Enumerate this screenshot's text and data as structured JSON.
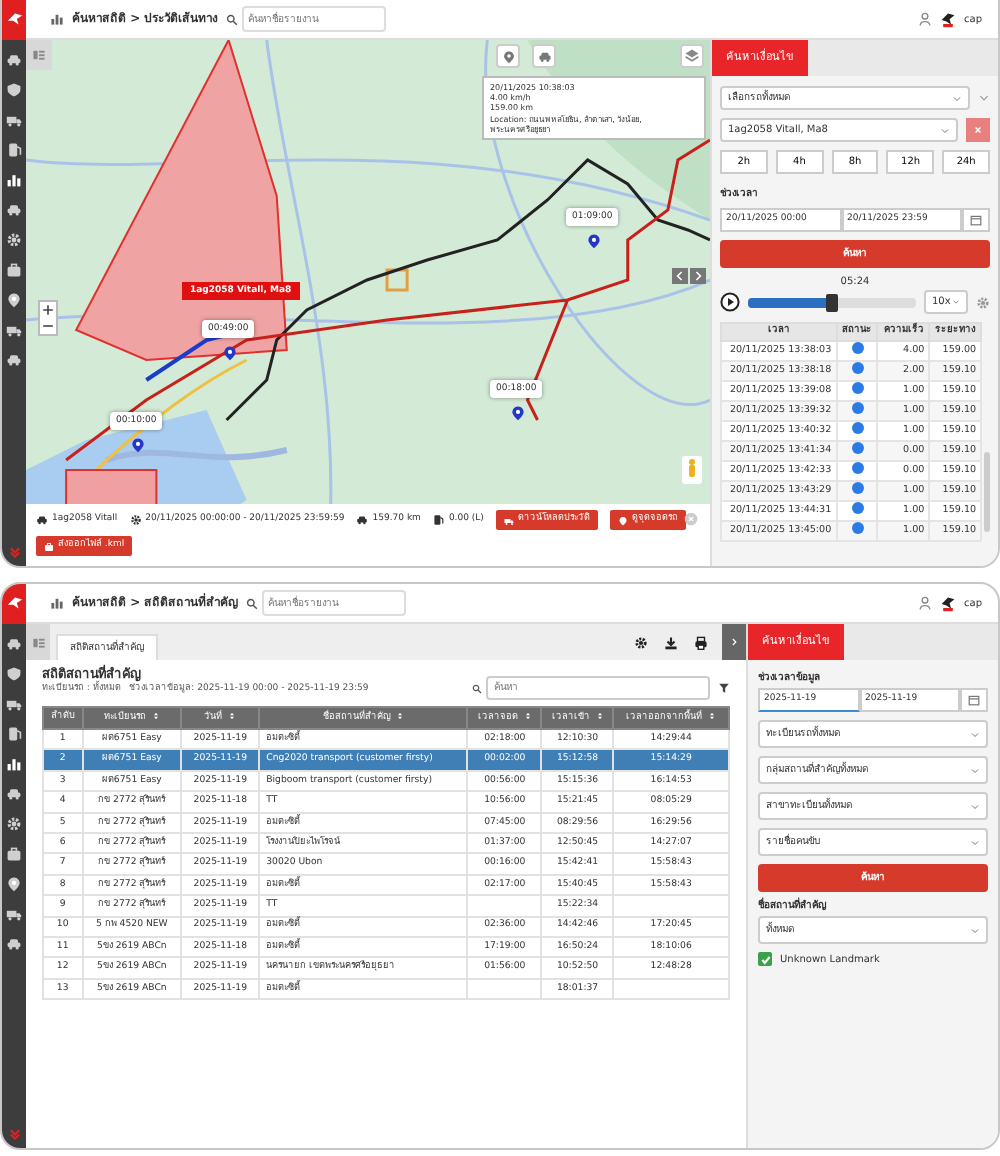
{
  "history_screen": {
    "breadcrumb": "ค้นหาสถิติ > ประวัติเส้นทาง",
    "search": {
      "placeholder": "ค้นหาชื่อรายงาน"
    },
    "user": "cap",
    "map": {
      "info_lines": [
        "20/11/2025 10:38:03",
        "4.00 km/h",
        "159.00 km",
        "Location: ถนนพหลโยธิน, ลำตาเสา, วังน้อย, พระนครศรีอยุธยา"
      ],
      "time_labels": [
        "01:09:00",
        "00:18:00",
        "00:49:00",
        "00:10:00"
      ],
      "vehicle_label": "1ag2058 Vitall, Ma8",
      "summary": {
        "plate": "1ag2058 Vitall",
        "period": "20/11/2025 00:00:00 - 20/11/2025 23:59:59",
        "distance": "159.70 km",
        "fuel": "0.00 (L)"
      },
      "buttons": [
        "ดาวน์โหลดประวัติ",
        "ดูจุดจอดรถ",
        "ส่งออกไฟล์ .kml"
      ]
    },
    "panel": {
      "tab": "ค้นหาเงื่อนไข",
      "group_select": "เลือกรถทั้งหมด",
      "vehicle_select": "1ag2058 Vitall, Ma8",
      "ranges": [
        {
          "label": "2h",
          "selected": false
        },
        {
          "label": "4h",
          "selected": false
        },
        {
          "label": "8h",
          "selected": false
        },
        {
          "label": "12h",
          "selected": false
        },
        {
          "label": "24h",
          "selected": false
        }
      ],
      "period_label": "ช่วงเวลา",
      "date_from": "20/11/2025 00:00",
      "date_to": "20/11/2025 23:59",
      "search_button": "ค้นหา",
      "playback": {
        "time": "05:24",
        "level": 0.5,
        "speed": "10x"
      },
      "table": {
        "columns": [
          "เวลา",
          "สถานะ",
          "ความเร็ว",
          "ระยะทาง"
        ],
        "rows": [
          {
            "time": "20/11/2025 13:38:03",
            "speed": "4.00",
            "distance": "159.00"
          },
          {
            "time": "20/11/2025 13:38:18",
            "speed": "2.00",
            "distance": "159.10"
          },
          {
            "time": "20/11/2025 13:39:08",
            "speed": "1.00",
            "distance": "159.10"
          },
          {
            "time": "20/11/2025 13:39:32",
            "speed": "1.00",
            "distance": "159.10"
          },
          {
            "time": "20/11/2025 13:40:32",
            "speed": "1.00",
            "distance": "159.10"
          },
          {
            "time": "20/11/2025 13:41:34",
            "speed": "0.00",
            "distance": "159.10"
          },
          {
            "time": "20/11/2025 13:42:33",
            "speed": "0.00",
            "distance": "159.10"
          },
          {
            "time": "20/11/2025 13:43:29",
            "speed": "1.00",
            "distance": "159.10"
          },
          {
            "time": "20/11/2025 13:44:31",
            "speed": "1.00",
            "distance": "159.10"
          },
          {
            "time": "20/11/2025 13:45:00",
            "speed": "1.00",
            "distance": "159.10"
          }
        ]
      }
    }
  },
  "landmark_screen": {
    "breadcrumb": "ค้นหาสถิติ > สถิติสถานที่สำคัญ",
    "search": {
      "placeholder": "ค้นหาชื่อรายงาน"
    },
    "user": "cap",
    "tab": "สถิติสถานที่สำคัญ",
    "title": "สถิติสถานที่สำคัญ",
    "subtitle": "ทะเบียนรถ : ทั้งหมด   ช่วงเวลาข้อมูล: 2025-11-19 00:00 - 2025-11-19 23:59",
    "table_search": {
      "placeholder": "ค้นหา"
    },
    "table": {
      "columns": [
        "ลำดับ",
        "ทะเบียนรถ",
        "วันที่",
        "ชื่อสถานที่สำคัญ",
        "เวลาจอด",
        "เวลาเข้า",
        "เวลาออกจากพื้นที่"
      ],
      "rows": [
        {
          "cells": [
            "1",
            "ผต6751 Easy",
            "2025-11-19",
            "อมตะซิตี้",
            "02:18:00",
            "12:10:30",
            "14:29:44"
          ],
          "selected": false
        },
        {
          "cells": [
            "2",
            "ผต6751 Easy",
            "2025-11-19",
            "Cng2020 transport (customer firsty)",
            "00:02:00",
            "15:12:58",
            "15:14:29"
          ],
          "selected": true
        },
        {
          "cells": [
            "3",
            "ผต6751 Easy",
            "2025-11-19",
            "Bigboom transport (customer firsty)",
            "00:56:00",
            "15:15:36",
            "16:14:53"
          ],
          "selected": false
        },
        {
          "cells": [
            "4",
            "กข 2772 สุรินทร์",
            "2025-11-18",
            "TT",
            "10:56:00",
            "15:21:45",
            "08:05:29"
          ],
          "selected": false
        },
        {
          "cells": [
            "5",
            "กข 2772 สุรินทร์",
            "2025-11-19",
            "อมตะซิตี้",
            "07:45:00",
            "08:29:56",
            "16:29:56"
          ],
          "selected": false
        },
        {
          "cells": [
            "6",
            "กข 2772 สุรินทร์",
            "2025-11-19",
            "โรงงานปิยะไพโรจน์",
            "01:37:00",
            "12:50:45",
            "14:27:07"
          ],
          "selected": false
        },
        {
          "cells": [
            "7",
            "กข 2772 สุรินทร์",
            "2025-11-19",
            "30020 Ubon",
            "00:16:00",
            "15:42:41",
            "15:58:43"
          ],
          "selected": false
        },
        {
          "cells": [
            "8",
            "กข 2772 สุรินทร์",
            "2025-11-19",
            "อมตะซิตี้",
            "02:17:00",
            "15:40:45",
            "15:58:43"
          ],
          "selected": false
        },
        {
          "cells": [
            "9",
            "กข 2772 สุรินทร์",
            "2025-11-19",
            "TT",
            "",
            "15:22:34",
            ""
          ],
          "selected": false
        },
        {
          "cells": [
            "10",
            "5 กพ 4520 NEW",
            "2025-11-19",
            "อมตะซิตี้",
            "02:36:00",
            "14:42:46",
            "17:20:45"
          ],
          "selected": false
        },
        {
          "cells": [
            "11",
            "5ขง 2619 ABCn",
            "2025-11-18",
            "อมตะซิตี้",
            "17:19:00",
            "16:50:24",
            "18:10:06"
          ],
          "selected": false
        },
        {
          "cells": [
            "12",
            "5ขง 2619 ABCn",
            "2025-11-19",
            "นครนายก เขตพระนครศรีอยุธยา",
            "01:56:00",
            "10:52:50",
            "12:48:28"
          ],
          "selected": false
        },
        {
          "cells": [
            "13",
            "5ขง 2619 ABCn",
            "2025-11-19",
            "อมตะซิตี้",
            "",
            "18:01:37",
            ""
          ],
          "selected": false
        }
      ]
    },
    "panel": {
      "tab": "ค้นหาเงื่อนไข",
      "period_label": "ช่วงเวลาข้อมูล",
      "date_from": "2025-11-19",
      "date_to": "2025-11-19",
      "selects": [
        "ทะเบียนรถทั้งหมด",
        "กลุ่มสถานที่สำคัญทั้งหมด",
        "สาขาทะเบียนทั้งหมด",
        "รายชื่อคนขับ"
      ],
      "search_button": "ค้นหา",
      "landmark_label": "ชื่อสถานที่สำคัญ",
      "landmark_select": "ทั้งหมด",
      "unknown_landmark": {
        "label": "Unknown Landmark",
        "checked": true
      }
    }
  }
}
